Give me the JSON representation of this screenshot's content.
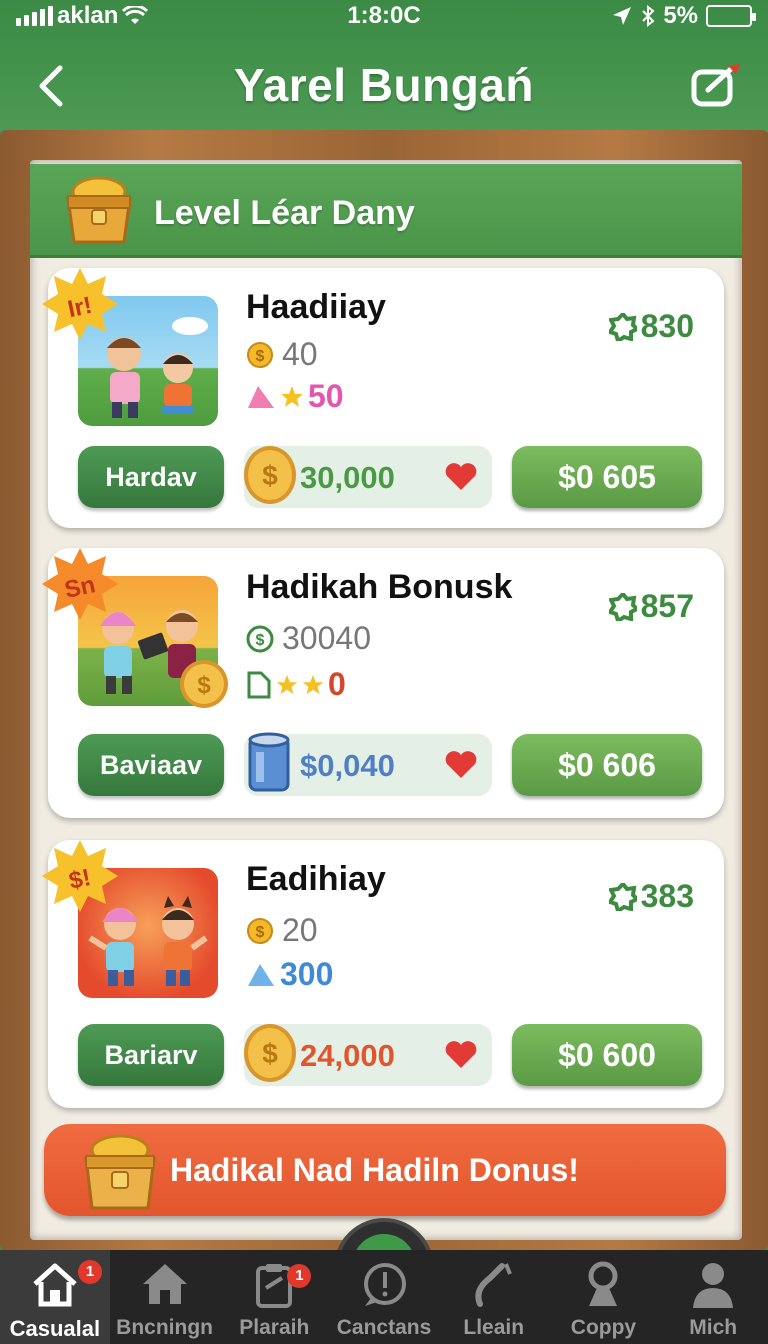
{
  "status_bar": {
    "carrier": "aklan",
    "time": "1:8:0C",
    "battery": "5%"
  },
  "header": {
    "title": "Yarel Bungań"
  },
  "banner": {
    "title": "Level Léar Dany"
  },
  "offers": [
    {
      "badge": "Ir!",
      "title": "Haadiiay",
      "stat_value": "40",
      "stars_value": "50",
      "score": "830",
      "name_button": "Hardav",
      "amount": "30,000",
      "price": "$0 605"
    },
    {
      "badge": "Sn",
      "title": "Hadikah Bonusk",
      "stat_value": "30040",
      "stars_value": "0",
      "score": "857",
      "name_button": "Baviaav",
      "amount": "$0,040",
      "price": "$0 606"
    },
    {
      "badge": "$!",
      "title": "Eadihiay",
      "stat_value": "20",
      "stars_value": "300",
      "score": "383",
      "name_button": "Bariarv",
      "amount": "24,000",
      "price": "$0 600"
    }
  ],
  "bonus_button": {
    "label": "Hadikal Nad Hadiln Donus!"
  },
  "tabbar": {
    "tabs": [
      {
        "label": "Casualal",
        "badge": "1"
      },
      {
        "label": "Bncningn"
      },
      {
        "label": "Plaraih",
        "badge": "1"
      },
      {
        "label": "Canctans"
      },
      {
        "label": "Lleain"
      },
      {
        "label": "Coppy"
      },
      {
        "label": "Mich"
      }
    ]
  },
  "colors": {
    "header_green": "#3b8a45",
    "score_green": "#3d8b40",
    "price_green": "#6aab50",
    "bonus_orange": "#e95f34",
    "tab_bar": "#252525"
  },
  "icons": [
    "back-arrow-icon",
    "edit-share-icon",
    "treasure-chest-icon",
    "gold-coin-icon",
    "dollar-coin-icon",
    "gem-icon",
    "star-icon",
    "gear-badge-icon",
    "heart-icon",
    "can-icon",
    "home-icon",
    "clipboard-icon",
    "chat-icon",
    "phone-icon",
    "search-person-icon",
    "person-icon"
  ]
}
